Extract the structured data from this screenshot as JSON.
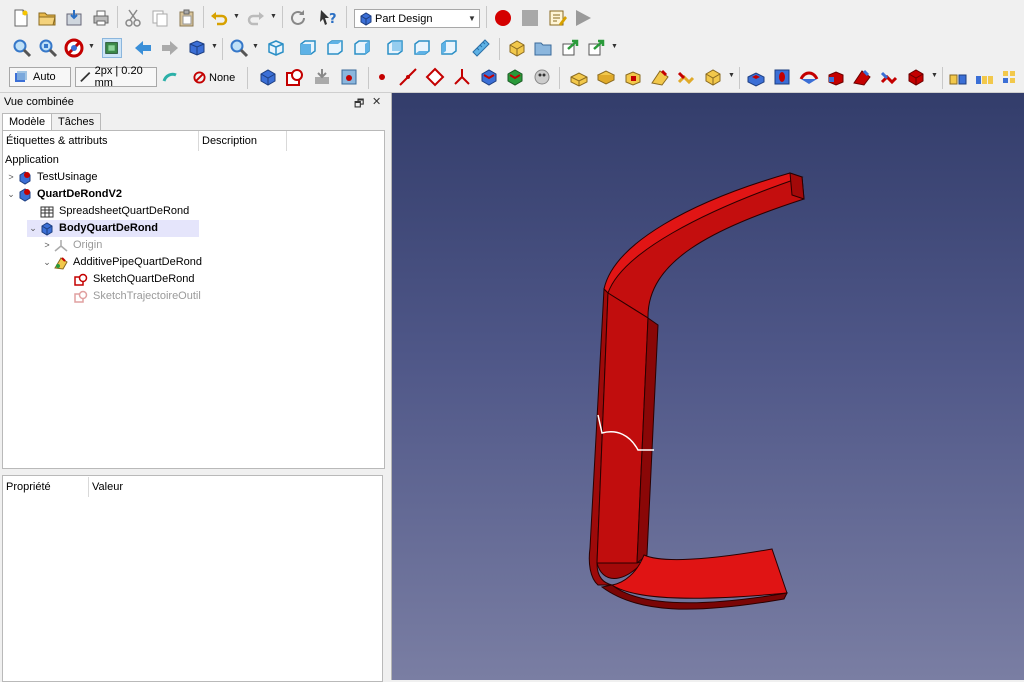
{
  "toolbar": {
    "workbench": "Part Design",
    "draw_style": "Auto",
    "line_width": "2px | 0.20 mm",
    "selection_filter": "None"
  },
  "combo_view": {
    "title": "Vue combinée",
    "tabs": [
      "Modèle",
      "Tâches"
    ],
    "tree_headers": [
      "Étiquettes & attributs",
      "Description"
    ],
    "root_label": "Application",
    "items": [
      {
        "label": "TestUsinage"
      },
      {
        "label": "QuartDeRondV2"
      },
      {
        "label": "SpreadsheetQuartDeRond"
      },
      {
        "label": "BodyQuartDeRond"
      },
      {
        "label": "Origin"
      },
      {
        "label": "AdditivePipeQuartDeRond"
      },
      {
        "label": "SketchQuartDeRond"
      },
      {
        "label": "SketchTrajectoireOutil"
      }
    ],
    "property_headers": [
      "Propriété",
      "Valeur"
    ]
  },
  "colors": {
    "shape": "#d40f0f",
    "selection_highlight": "#e5e5fb",
    "viewport_top": "#333d6b",
    "viewport_bottom": "#7a7ea3"
  }
}
